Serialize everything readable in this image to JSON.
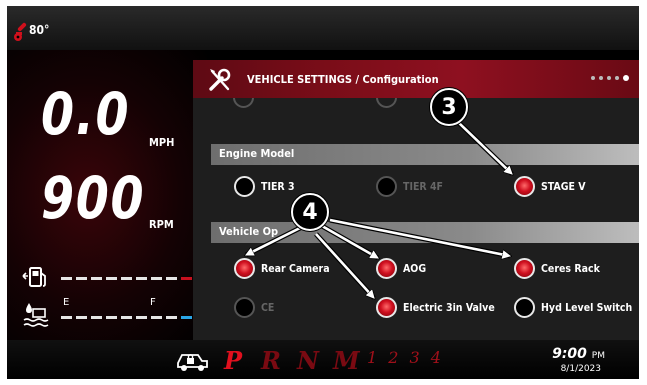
{
  "status": {
    "temperature": "80°"
  },
  "speed": {
    "value": "0.0",
    "unit": "MPH"
  },
  "rpm": {
    "value": "900",
    "unit": "RPM"
  },
  "gauges": {
    "fuel_level_fraction": 0.9,
    "hydraulic": {
      "empty_label": "E",
      "full_label": "F",
      "level_fraction": 0.95
    }
  },
  "settings": {
    "title": "VEHICLE SETTINGS / Configuration",
    "page_dots": 5,
    "active_dot": 4,
    "sections": [
      {
        "label": "Engine Model",
        "options": [
          {
            "label": "TIER 3",
            "state": "unselected"
          },
          {
            "label": "TIER 4F",
            "state": "disabled"
          },
          {
            "label": "STAGE V",
            "state": "selected"
          }
        ]
      },
      {
        "label": "Vehicle Op",
        "options": [
          {
            "label": "Rear Camera",
            "state": "selected"
          },
          {
            "label": "AOG",
            "state": "selected"
          },
          {
            "label": "Ceres Rack",
            "state": "selected"
          },
          {
            "label": "CE",
            "state": "disabled"
          },
          {
            "label": "Electric 3in Valve",
            "state": "selected"
          },
          {
            "label": "Hyd Level Switch",
            "state": "unselected"
          }
        ]
      }
    ]
  },
  "gear_selector": {
    "gears": [
      "P",
      "R",
      "N",
      "M"
    ],
    "numbers": "1 2 3 4"
  },
  "clock": {
    "time": "9:00",
    "period": "PM",
    "date": "8/1/2023"
  },
  "callouts": [
    "3",
    "4"
  ],
  "colors": {
    "accent_red": "#c8101e",
    "header_red": "#7a0d18",
    "background": "#000000"
  }
}
